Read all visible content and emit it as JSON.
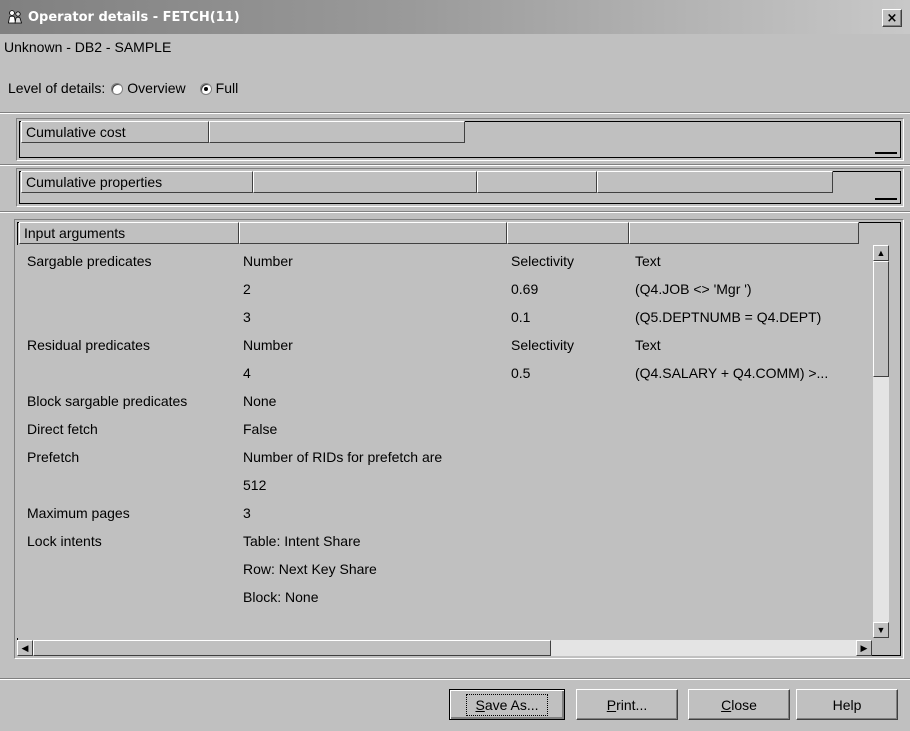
{
  "window": {
    "title": "Operator details - FETCH(11)",
    "close_glyph": "×",
    "icon": "operator-people-icon"
  },
  "subtitle": "Unknown - DB2 - SAMPLE",
  "level_of_details": {
    "label": "Level of details:",
    "options": [
      {
        "label": "Overview",
        "selected": false
      },
      {
        "label": "Full",
        "selected": true
      }
    ]
  },
  "cumulative_cost": {
    "header": "Cumulative cost"
  },
  "cumulative_properties": {
    "header": "Cumulative properties"
  },
  "input_arguments": {
    "header": "Input arguments",
    "rows": [
      [
        "Sargable predicates",
        "Number",
        "Selectivity",
        "Text"
      ],
      [
        "",
        "2",
        "0.69",
        "(Q4.JOB <> 'Mgr  ')"
      ],
      [
        "",
        "3",
        "0.1",
        "(Q5.DEPTNUMB = Q4.DEPT)"
      ],
      [
        "Residual predicates",
        "Number",
        "Selectivity",
        "Text"
      ],
      [
        "",
        "4",
        "0.5",
        "(Q4.SALARY + Q4.COMM) >..."
      ],
      [
        "Block sargable predicates",
        "None",
        "",
        ""
      ],
      [
        "Direct fetch",
        "False",
        "",
        ""
      ],
      [
        "Prefetch",
        "Number of RIDs for prefetch are",
        "",
        ""
      ],
      [
        "",
        "512",
        "",
        ""
      ],
      [
        "Maximum pages",
        "3",
        "",
        ""
      ],
      [
        "Lock intents",
        "Table: Intent Share",
        "",
        ""
      ],
      [
        "",
        "Row: Next Key Share",
        "",
        ""
      ],
      [
        "",
        "Block: None",
        "",
        ""
      ]
    ]
  },
  "scroll": {
    "up": "▲",
    "down": "▼",
    "left": "◀",
    "right": "▶"
  },
  "buttons": {
    "save_as": {
      "mnemonic": "S",
      "rest": "ave As..."
    },
    "print": {
      "mnemonic": "P",
      "rest": "rint..."
    },
    "close": {
      "mnemonic": "C",
      "rest": "lose"
    },
    "help": "Help"
  }
}
